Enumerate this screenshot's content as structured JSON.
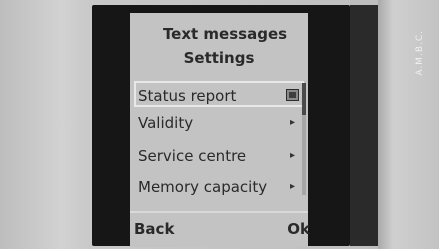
{
  "header": {
    "title_line1": "Text messages",
    "title_line2": "Settings"
  },
  "menu": {
    "items": [
      {
        "label": "Status report",
        "control": "checkbox",
        "checked": true,
        "selected": true
      },
      {
        "label": "Validity",
        "control": "chevron-right"
      },
      {
        "label": "Service centre",
        "control": "chevron-right"
      },
      {
        "label": "Memory capacity",
        "control": "chevron-right"
      }
    ]
  },
  "softkeys": {
    "left": "Back",
    "right": "Ok"
  },
  "side_text": "A.M.B.C.",
  "colors": {
    "screen": "#c3c3c3",
    "bezel": "#161616",
    "text": "#2a2a2a",
    "highlight": "#e8e8e8"
  }
}
